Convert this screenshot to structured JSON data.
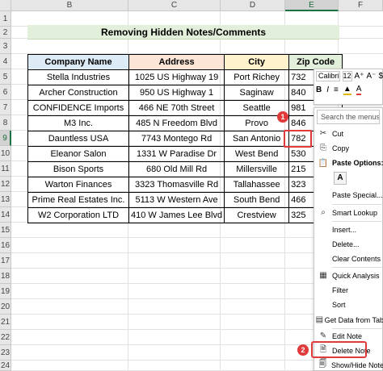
{
  "columns": [
    "B",
    "C",
    "D",
    "E",
    "F"
  ],
  "rows": [
    "1",
    "2",
    "3",
    "4",
    "5",
    "6",
    "7",
    "8",
    "9",
    "10",
    "11",
    "12",
    "13",
    "14",
    "15",
    "16",
    "17",
    "18",
    "19",
    "20",
    "21",
    "22",
    "23",
    "24"
  ],
  "title": "Removing Hidden Notes/Comments",
  "table": {
    "headers": [
      "Company Name",
      "Address",
      "City",
      "Zip Code"
    ],
    "rows": [
      [
        "Stella Industries",
        "1025 US Highway 19",
        "Port Richey",
        "732"
      ],
      [
        "Archer Construction",
        "950 US Highway 1",
        "Saginaw",
        "840"
      ],
      [
        "CONFIDENCE Imports",
        "466 NE 70th Street",
        "Seattle",
        "981"
      ],
      [
        "M3 Inc.",
        "485 N Freedom Blvd",
        "Provo",
        "846"
      ],
      [
        "Dauntless USA",
        "7743 Montego Rd",
        "San Antonio",
        "782"
      ],
      [
        "Eleanor Salon",
        "1331 W Paradise Dr",
        "West Bend",
        "530"
      ],
      [
        "Bison Sports",
        "680 Old Mill Rd",
        "Millersville",
        "215"
      ],
      [
        "Warton Finances",
        "3323 Thomasville Rd",
        "Tallahassee",
        "323"
      ],
      [
        "Prime Real Estates Inc.",
        "5113 W Western Ave",
        "South Bend",
        "466"
      ],
      [
        "W2 Corporation LTD",
        "410 W James Lee Blvd",
        "Crestview",
        "325"
      ]
    ]
  },
  "mini_toolbar": {
    "font_name": "Calibri",
    "font_size": "12",
    "row1_buttons": [
      "A⁺",
      "A⁻",
      "$"
    ],
    "row2_buttons": [
      "B",
      "I",
      "≡",
      "A"
    ]
  },
  "context_menu": {
    "search_placeholder": "Search the menus",
    "cut": "Cut",
    "copy": "Copy",
    "paste_options": "Paste Options:",
    "paste_special": "Paste Special...",
    "smart_lookup": "Smart Lookup",
    "insert": "Insert...",
    "delete": "Delete...",
    "clear_contents": "Clear Contents",
    "quick_analysis": "Quick Analysis",
    "filter": "Filter",
    "sort": "Sort",
    "get_data": "Get Data from Tab",
    "edit_note": "Edit Note",
    "delete_note": "Delete Note",
    "show_hide_note": "Show/Hide Note"
  },
  "badges": [
    "1",
    "2"
  ],
  "colors": {
    "header_company": "#ddebf7",
    "header_address": "#fce4d6",
    "header_city": "#fff2cc",
    "header_zip": "#e2efda",
    "title_band": "#e2efda",
    "highlight_red": "#e03a3a"
  },
  "icons": {
    "cut": "scissors-icon",
    "copy": "copy-icon",
    "paste": "clipboard-icon",
    "smart_lookup": "search-icon",
    "quick_analysis": "quick-analysis-icon",
    "get_data": "table-icon",
    "edit_note": "note-edit-icon",
    "delete_note": "note-delete-icon",
    "show_hide_note": "note-show-icon"
  }
}
